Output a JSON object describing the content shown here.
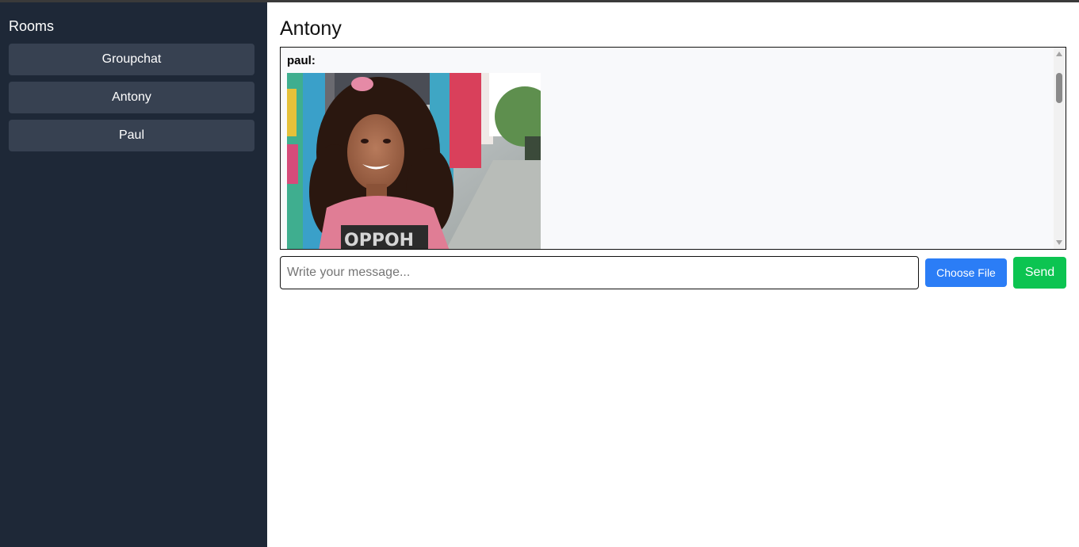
{
  "sidebar": {
    "title": "Rooms",
    "rooms": [
      {
        "label": "Groupchat"
      },
      {
        "label": "Antony"
      },
      {
        "label": "Paul"
      }
    ]
  },
  "chat": {
    "title": "Antony",
    "messages": [
      {
        "sender": "paul:",
        "type": "image",
        "image_desc": "photo"
      }
    ]
  },
  "composer": {
    "placeholder": "Write your message...",
    "value": "",
    "choose_file_label": "Choose File",
    "send_label": "Send"
  },
  "colors": {
    "sidebar_bg": "#1e2837",
    "room_button_bg": "#374151",
    "choose_file_bg": "#2b7df6",
    "send_bg": "#0cc451",
    "messages_bg": "#f8f9fb"
  }
}
